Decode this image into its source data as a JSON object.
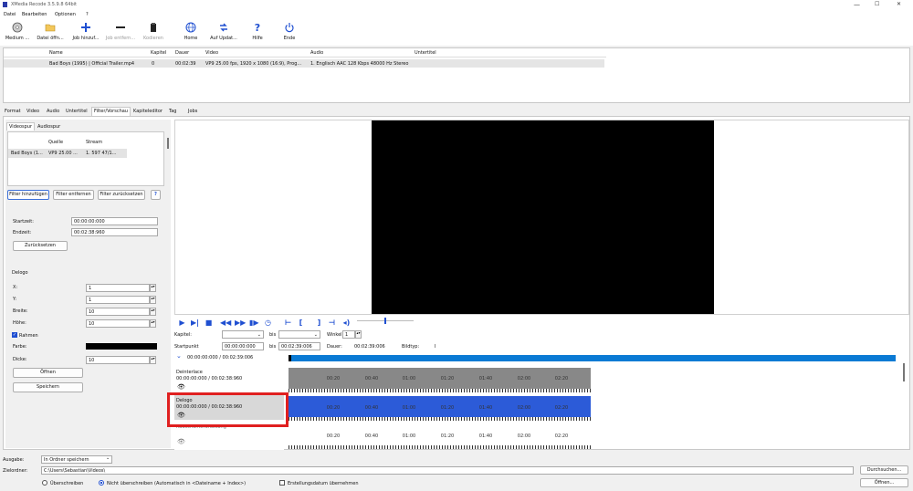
{
  "window": {
    "title": "XMedia Recode 3.5.9.8 64bit"
  },
  "menu": [
    "Datei",
    "Bearbeiten",
    "Optionen",
    "?"
  ],
  "toolbar": [
    {
      "label": "Medium ...",
      "icon": "disc-icon"
    },
    {
      "label": "Datei öffn...",
      "icon": "folder-open-icon"
    },
    {
      "label": "Job hinzuf...",
      "icon": "plus-icon"
    },
    {
      "label": "Job entfern...",
      "icon": "minus-icon"
    },
    {
      "label": "Kodieren",
      "icon": "encode-icon"
    },
    {
      "label": "Home",
      "icon": "globe-icon"
    },
    {
      "label": "Auf Updat...",
      "icon": "update-icon"
    },
    {
      "label": "Hilfe",
      "icon": "help-icon"
    },
    {
      "label": "Ende",
      "icon": "power-icon"
    }
  ],
  "file_table": {
    "headers": [
      "Name",
      "Kapitel",
      "Dauer",
      "Video",
      "Audio",
      "Untertitel"
    ],
    "row": [
      "Bad Boys (1995) | Official Trailer.mp4",
      "0",
      "00:02:39",
      "VP9 25.00 fps, 1920 x 1080 (16:9), Prog...",
      "1. Englisch AAC 128 Kbps 48000 Hz Stereo",
      ""
    ]
  },
  "main_tabs": [
    "Format",
    "Video",
    "Audio",
    "Untertitel",
    "Filter/Vorschau",
    "Kapiteleditor",
    "Tag",
    "Jobs"
  ],
  "active_main_tab": "Filter/Vorschau",
  "sub_tabs": [
    "Videospur",
    "Audiospur"
  ],
  "track_table": {
    "headers": [
      "Quelle",
      "Stream"
    ],
    "row": [
      "Bad Boys (1...",
      "VP9 25.00 ...",
      "1. 597 47/1..."
    ]
  },
  "filter_buttons": {
    "add": "Filter hinzufügen",
    "remove": "Filter entfernen",
    "reset": "Filter zurücksetzen",
    "help": "?"
  },
  "time": {
    "start_label": "Startzeit:",
    "start_value": "00:00:00:000",
    "end_label": "Endzeit:",
    "end_value": "00:02:38:960",
    "reset_button": "Zurücksetzen"
  },
  "delogo": {
    "title": "Delogo",
    "x_label": "X:",
    "x_value": "1",
    "y_label": "Y:",
    "y_value": "1",
    "width_label": "Breite:",
    "width_value": "10",
    "height_label": "Höhe:",
    "height_value": "10",
    "frame_label": "Rahmen",
    "color_label": "Farbe:",
    "color_value": "#000000",
    "strength_label": "Dicke:",
    "strength_value": "10",
    "open_button": "Öffnen",
    "save_button": "Speichern"
  },
  "player": {
    "chapter_label": "Kapitel:",
    "to_label": "bis",
    "angle_label": "Winkel",
    "angle_value": "1",
    "startpoint_label": "Startpunkt",
    "startpoint_value": "00:00:00:000",
    "to2_label": "bis",
    "to2_value": "00:02:39:006",
    "duration_label": "Dauer:",
    "duration_value": "00:02:39:006",
    "frametype_label": "Bildtyp:",
    "frametype_value": "I",
    "range": "00:00:00:000 / 00:02:39:006"
  },
  "tracks": [
    {
      "name": "Deinterlace",
      "range": "00:00:00:000 / 00:02:38:960"
    },
    {
      "name": "Delogo",
      "range": "00:00:00:000 / 00:02:38:960"
    },
    {
      "name": "Rauschunterdrückung",
      "range": ""
    }
  ],
  "timeline_ticks": [
    "00:20",
    "00:40",
    "01:00",
    "01:20",
    "01:40",
    "02:00",
    "02:20"
  ],
  "bottom": {
    "output_label": "Ausgabe:",
    "output_value": "In Ordner speichern",
    "target_label": "Zielordner:",
    "target_value": "C:\\Users\\Sebastian\\Videos\\",
    "browse_button": "Durchsuchen...",
    "open_button": "Öffnen...",
    "radio_overwrite": "Überschreiben",
    "radio_no_overwrite": "Nicht überschreiben (Automatisch in <Dateiname + Index>)",
    "keep_date": "Erstellungsdatum übernehmen"
  },
  "colors": {
    "accent": "#1f4fd1",
    "highlight": "#e02020",
    "timeline_blue": "#0a7ad4"
  }
}
